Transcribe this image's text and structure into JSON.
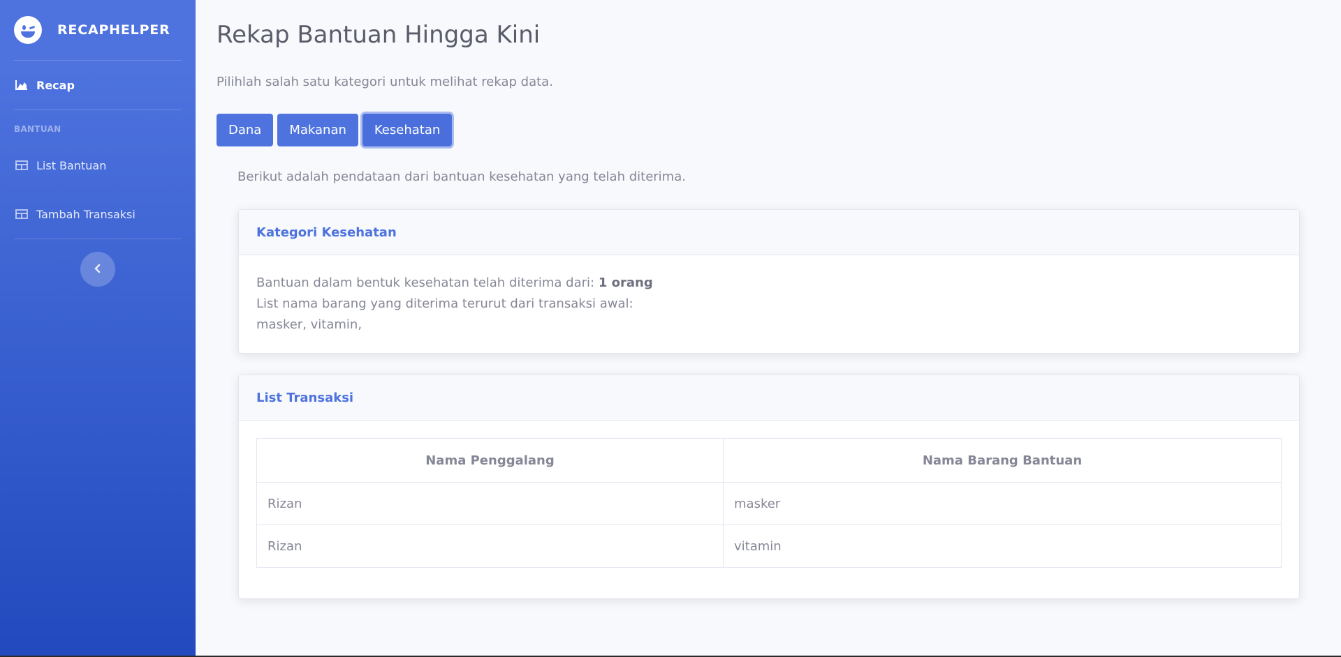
{
  "sidebar": {
    "brand": "RECAPHELPER",
    "items": [
      {
        "label": "Recap"
      },
      {
        "label": "List Bantuan"
      },
      {
        "label": "Tambah Transaksi"
      }
    ],
    "heading": "BANTUAN"
  },
  "main": {
    "title": "Rekap Bantuan Hingga Kini",
    "lead": "Pilihlah salah satu kategori untuk melihat rekap data.",
    "buttons": [
      "Dana",
      "Makanan",
      "Kesehatan"
    ],
    "info": "Berikut adalah pendataan dari bantuan kesehatan yang telah diterima."
  },
  "category_card": {
    "title": "Kategori Kesehatan",
    "line1_prefix": "Bantuan dalam bentuk kesehatan telah diterima dari: ",
    "line1_count": "1 orang",
    "line2": "List nama barang yang diterima terurut dari transaksi awal:",
    "line3": "masker, vitamin,"
  },
  "transactions": {
    "title": "List Transaksi",
    "columns": [
      "Nama Penggalang",
      "Nama Barang Bantuan"
    ],
    "rows": [
      [
        "Rizan",
        "masker"
      ],
      [
        "Rizan",
        "vitamin"
      ]
    ]
  },
  "colors": {
    "primary": "#4e73df",
    "text": "#858796",
    "heading": "#5a5c69"
  }
}
